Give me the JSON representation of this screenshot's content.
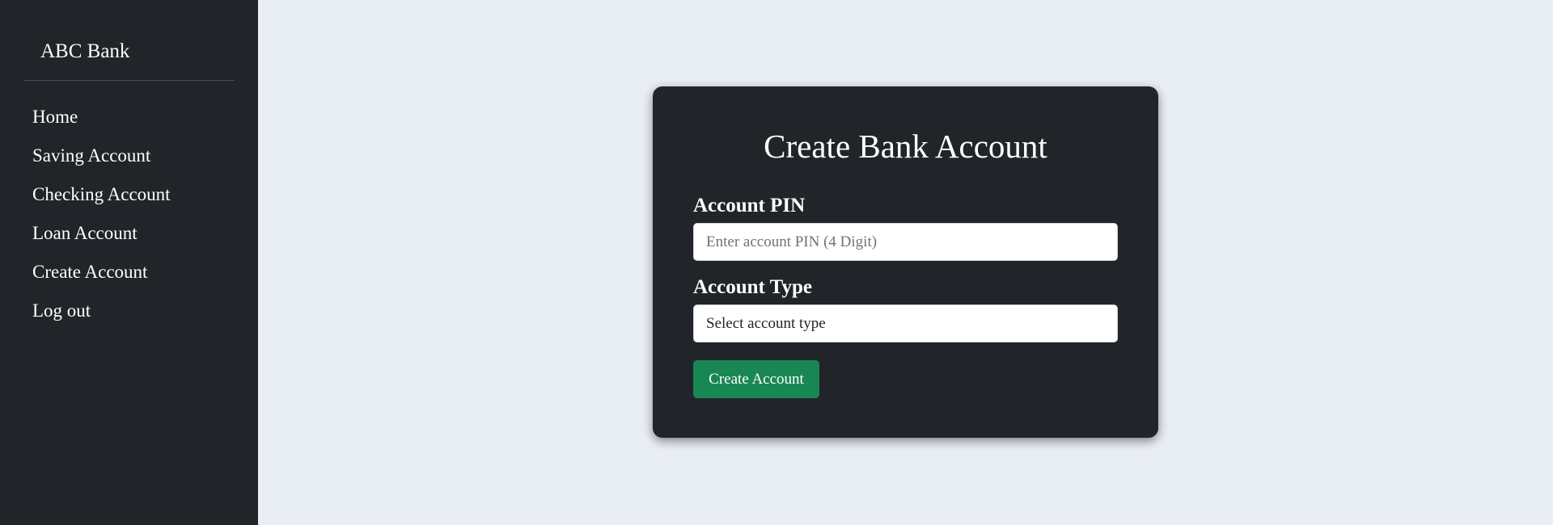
{
  "sidebar": {
    "brand": "ABC Bank",
    "items": [
      {
        "label": "Home"
      },
      {
        "label": "Saving Account"
      },
      {
        "label": "Checking Account"
      },
      {
        "label": "Loan Account"
      },
      {
        "label": "Create Account"
      },
      {
        "label": "Log out"
      }
    ]
  },
  "form": {
    "title": "Create Bank Account",
    "pin_label": "Account PIN",
    "pin_placeholder": "Enter account PIN (4 Digit)",
    "pin_value": "",
    "type_label": "Account Type",
    "type_selected": "Select account type",
    "submit_label": "Create Account"
  },
  "colors": {
    "sidebar_bg": "#212529",
    "page_bg": "#e9edf4",
    "card_bg": "#212529",
    "button_bg": "#198754"
  }
}
